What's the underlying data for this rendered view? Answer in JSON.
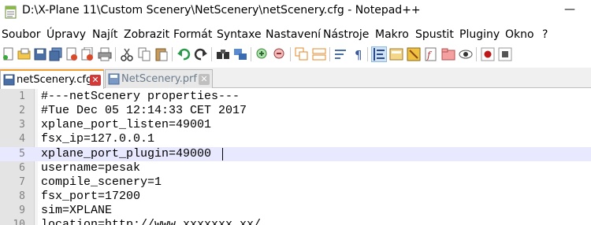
{
  "window": {
    "title": "D:\\X-Plane 11\\Custom Scenery\\NetScenery\\netScenery.cfg - Notepad++",
    "minimize_label": "—"
  },
  "menu": [
    "Soubor",
    "Úpravy",
    "Najít",
    "Zobrazit",
    "Formát",
    "Syntaxe",
    "Nastavení",
    "Nástroje",
    "Makro",
    "Spustit",
    "Pluginy",
    "Okno",
    "?"
  ],
  "toolbar": {
    "icons": [
      "new-file-icon",
      "open-file-icon",
      "save-icon",
      "save-all-icon",
      "close-icon",
      "close-all-icon",
      "print-icon",
      "cut-icon",
      "copy-icon",
      "paste-icon",
      "undo-icon",
      "redo-icon",
      "find-icon",
      "replace-icon",
      "zoom-in-icon",
      "zoom-out-icon",
      "sync-vertical-icon",
      "sync-horizontal-icon",
      "word-wrap-icon",
      "show-all-chars-icon",
      "indent-guide-icon",
      "user-language-icon",
      "document-map-icon",
      "function-list-icon",
      "folder-workspace-icon",
      "monitoring-icon",
      "record-macro-icon",
      "stop-macro-icon"
    ]
  },
  "tabs": [
    {
      "label": "netScenery.cfg",
      "active": true,
      "close": "✕"
    },
    {
      "label": "NetScenery.prf",
      "active": false,
      "close": "✕"
    }
  ],
  "editor": {
    "current_line": 5,
    "lines": [
      {
        "num": "1",
        "text": "#---netScenery properties---"
      },
      {
        "num": "2",
        "text": "#Tue Dec 05 12:14:33 CET 2017"
      },
      {
        "num": "3",
        "text": "xplane_port_listen=49001"
      },
      {
        "num": "4",
        "text": "fsx_ip=127.0.0.1"
      },
      {
        "num": "5",
        "text": "xplane_port_plugin=49000"
      },
      {
        "num": "6",
        "text": "username=pesak"
      },
      {
        "num": "7",
        "text": "compile_scenery=1"
      },
      {
        "num": "8",
        "text": "fsx_port=17200"
      },
      {
        "num": "9",
        "text": "sim=XPLANE"
      },
      {
        "num": "10",
        "text": "location=http://www.xxxxxxx.xx/"
      }
    ]
  },
  "colors": {
    "current_line": "#e8e8ff",
    "active_tab_accent": "#f0a030",
    "close_active": "#d23a3a"
  }
}
